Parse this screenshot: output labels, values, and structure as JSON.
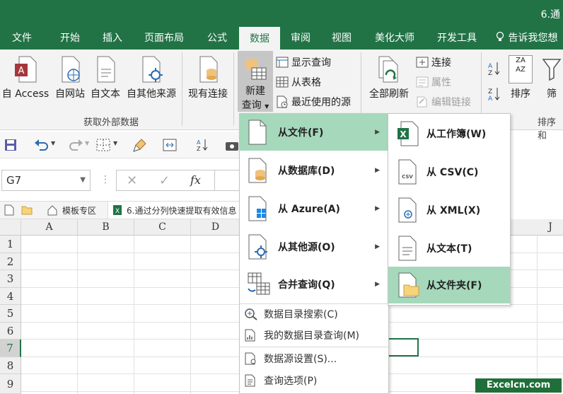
{
  "title": {
    "doc": "6.通"
  },
  "tabs": [
    "文件",
    "开始",
    "插入",
    "页面布局",
    "公式",
    "数据",
    "审阅",
    "视图",
    "美化大师",
    "开发工具"
  ],
  "tellme": "告诉我您想",
  "ribbon": {
    "from_access": "自 Access",
    "from_web": "自网站",
    "from_text": "自文本",
    "from_other": "自其他来源",
    "existing": "现有连接",
    "new_query_1": "新建",
    "new_query_2": "查询",
    "show_query": "显示查询",
    "from_table": "从表格",
    "recent_sources": "最近使用的源",
    "refresh_all": "全部刷新",
    "connections": "连接",
    "properties": "属性",
    "edit_links": "编辑链接",
    "sort": "排序",
    "filter": "筛",
    "group_external": "获取外部数据",
    "group_sort": "排序和",
    "za": "ZA",
    "az": "AZ"
  },
  "formula": {
    "cell": "G7",
    "fx": "fx"
  },
  "sheettabs": {
    "template": "模板专区",
    "doc": "6.通过分列快速提取有效信息"
  },
  "columns": [
    "A",
    "B",
    "C",
    "D",
    "J"
  ],
  "rows": [
    "1",
    "2",
    "3",
    "4",
    "5",
    "6",
    "7",
    "8",
    "9"
  ],
  "menu1": {
    "items": [
      {
        "label": "从文件(F)"
      },
      {
        "label": "从数据库(D)"
      },
      {
        "label": "从 Azure(A)"
      },
      {
        "label": "从其他源(O)"
      },
      {
        "label": "合并查询(Q)"
      }
    ],
    "small": [
      {
        "label": "数据目录搜索(C)"
      },
      {
        "label": "我的数据目录查询(M)"
      },
      {
        "label": "数据源设置(S)..."
      },
      {
        "label": "查询选项(P)"
      }
    ]
  },
  "menu2": {
    "items": [
      {
        "label": "从工作簿(W)"
      },
      {
        "label": "从 CSV(C)"
      },
      {
        "label": "从 XML(X)"
      },
      {
        "label": "从文本(T)"
      },
      {
        "label": "从文件夹(F)"
      }
    ]
  },
  "watermark": "Excelcn.com",
  "colors": {
    "brand": "#217346",
    "highlight": "#a6d8bc",
    "access": "#a4373a"
  }
}
